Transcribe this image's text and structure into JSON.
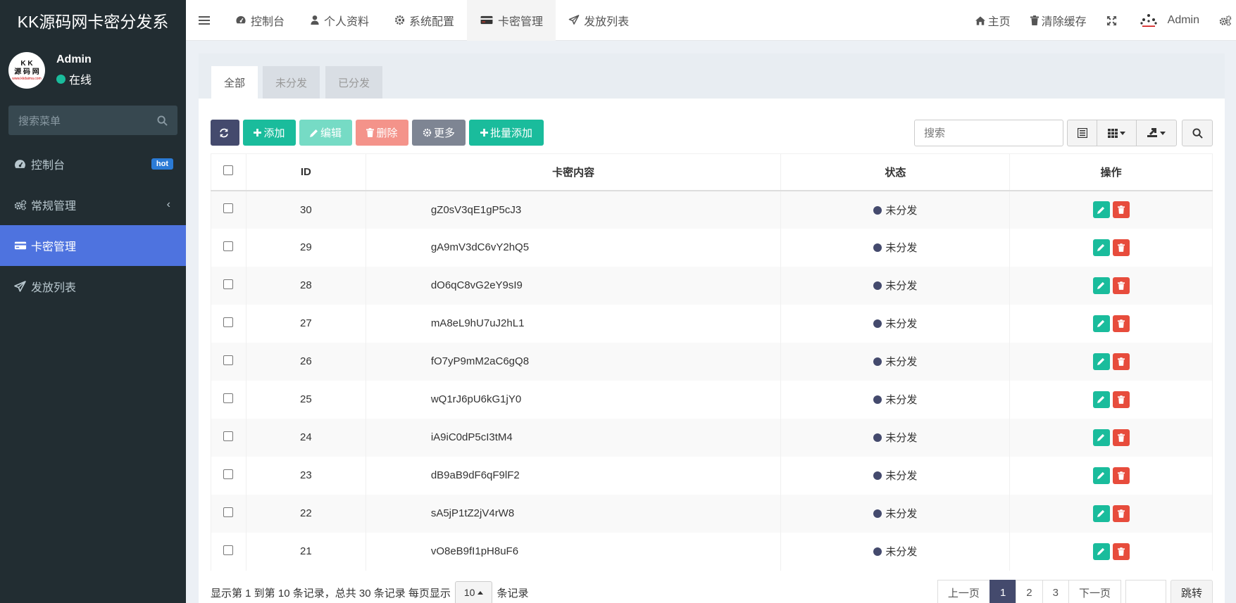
{
  "brand": {
    "title": "KK源码网卡密分发系"
  },
  "user": {
    "name": "Admin",
    "status": "在线",
    "avatar_line1": "K  K",
    "avatar_line2": "源 码 网",
    "avatar_line3": "www.kkdaima.com"
  },
  "sidebar": {
    "search_placeholder": "搜索菜单",
    "items": [
      {
        "label": "控制台",
        "badge": "hot"
      },
      {
        "label": "常规管理",
        "chevron": "‹"
      },
      {
        "label": "卡密管理"
      },
      {
        "label": "发放列表"
      }
    ]
  },
  "topnav": {
    "items": [
      {
        "label": "控制台"
      },
      {
        "label": "个人资料"
      },
      {
        "label": "系统配置"
      },
      {
        "label": "卡密管理"
      },
      {
        "label": "发放列表"
      }
    ],
    "home": "主页",
    "clear_cache": "清除缓存",
    "admin": "Admin"
  },
  "tabs": [
    "全部",
    "未分发",
    "已分发"
  ],
  "toolbar": {
    "add": "添加",
    "edit": "编辑",
    "delete": "删除",
    "more": "更多",
    "batch_add": "批量添加",
    "search_placeholder": "搜索"
  },
  "table": {
    "headers": {
      "id": "ID",
      "content": "卡密内容",
      "status": "状态",
      "ops": "操作"
    },
    "rows": [
      {
        "id": "30",
        "content": "gZ0sV3qE1gP5cJ3",
        "status": "未分发"
      },
      {
        "id": "29",
        "content": "gA9mV3dC6vY2hQ5",
        "status": "未分发"
      },
      {
        "id": "28",
        "content": "dO6qC8vG2eY9sI9",
        "status": "未分发"
      },
      {
        "id": "27",
        "content": "mA8eL9hU7uJ2hL1",
        "status": "未分发"
      },
      {
        "id": "26",
        "content": "fO7yP9mM2aC6gQ8",
        "status": "未分发"
      },
      {
        "id": "25",
        "content": "wQ1rJ6pU6kG1jY0",
        "status": "未分发"
      },
      {
        "id": "24",
        "content": "iA9iC0dP5cI3tM4",
        "status": "未分发"
      },
      {
        "id": "23",
        "content": "dB9aB9dF6qF9lF2",
        "status": "未分发"
      },
      {
        "id": "22",
        "content": "sA5jP1tZ2jV4rW8",
        "status": "未分发"
      },
      {
        "id": "21",
        "content": "vO8eB9fI1pH8uF6",
        "status": "未分发"
      }
    ]
  },
  "footer": {
    "info_prefix": "显示第 1 到第 10 条记录，总共 30 条记录 每页显示",
    "page_size": "10",
    "info_suffix": "条记录",
    "prev": "上一页",
    "pages": [
      "1",
      "2",
      "3"
    ],
    "next": "下一页",
    "jump": "跳转"
  },
  "colors": {
    "sidebar_bg": "#222d32",
    "active_menu": "#4e73df",
    "accent_green": "#1abc9c",
    "danger": "#e74c3c",
    "dark_navy": "#444a6d"
  }
}
